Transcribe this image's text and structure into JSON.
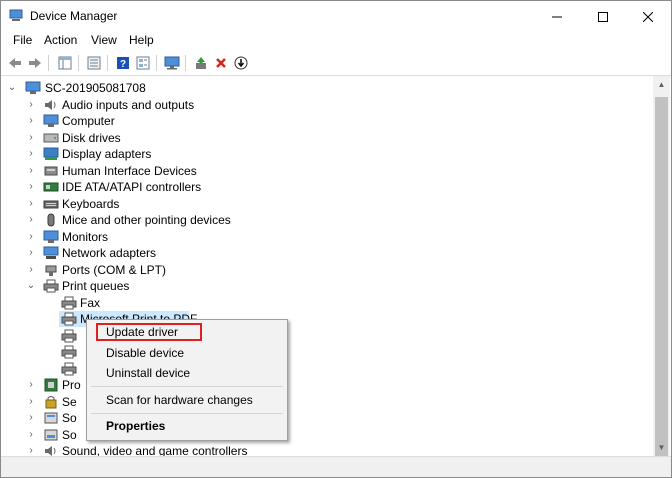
{
  "window": {
    "title": "Device Manager",
    "controls": [
      "minimize",
      "maximize",
      "close"
    ]
  },
  "menubar": {
    "items": [
      "File",
      "Action",
      "View",
      "Help"
    ]
  },
  "toolbar": {
    "buttons": [
      "back-icon",
      "forward-icon",
      "show-hide-tree-icon",
      "properties-icon",
      "help-icon",
      "view-icon",
      "scan-monitor-icon",
      "update-driver-icon",
      "uninstall-x-icon",
      "download-driver-icon"
    ],
    "accent_colors": {
      "help_blue": "#1a4fb8",
      "uninstall_red": "#d9241c",
      "update_green": "#2e9e3c"
    }
  },
  "tree": {
    "root": "SC-201905081708",
    "categories": [
      {
        "label": "Audio inputs and outputs",
        "icon": "speaker-icon"
      },
      {
        "label": "Computer",
        "icon": "computer-icon"
      },
      {
        "label": "Disk drives",
        "icon": "disk-drive-icon"
      },
      {
        "label": "Display adapters",
        "icon": "display-adapter-icon"
      },
      {
        "label": "Human Interface Devices",
        "icon": "hid-icon"
      },
      {
        "label": "IDE ATA/ATAPI controllers",
        "icon": "ide-controller-icon"
      },
      {
        "label": "Keyboards",
        "icon": "keyboard-icon"
      },
      {
        "label": "Mice and other pointing devices",
        "icon": "mouse-icon"
      },
      {
        "label": "Monitors",
        "icon": "monitor-icon"
      },
      {
        "label": "Network adapters",
        "icon": "network-adapter-icon"
      },
      {
        "label": "Ports (COM & LPT)",
        "icon": "port-icon"
      },
      {
        "label": "Print queues",
        "icon": "printer-icon",
        "expanded": true
      }
    ],
    "print_queue_children": [
      "Fax",
      "Microsoft Print to PDF",
      "",
      "",
      ""
    ],
    "after_print": [
      {
        "label": "Pro",
        "icon": "processor-icon"
      },
      {
        "label": "Se",
        "icon": "security-icon"
      },
      {
        "label": "So",
        "icon": "software-icon"
      },
      {
        "label": "So",
        "icon": "software-device-icon"
      },
      {
        "label": "Sound, video and game controllers",
        "icon": "sound-icon"
      }
    ]
  },
  "context_menu": {
    "items": [
      "Update driver",
      "Disable device",
      "Uninstall device",
      "Scan for hardware changes",
      "Properties"
    ],
    "highlight_color": "#e02020"
  }
}
